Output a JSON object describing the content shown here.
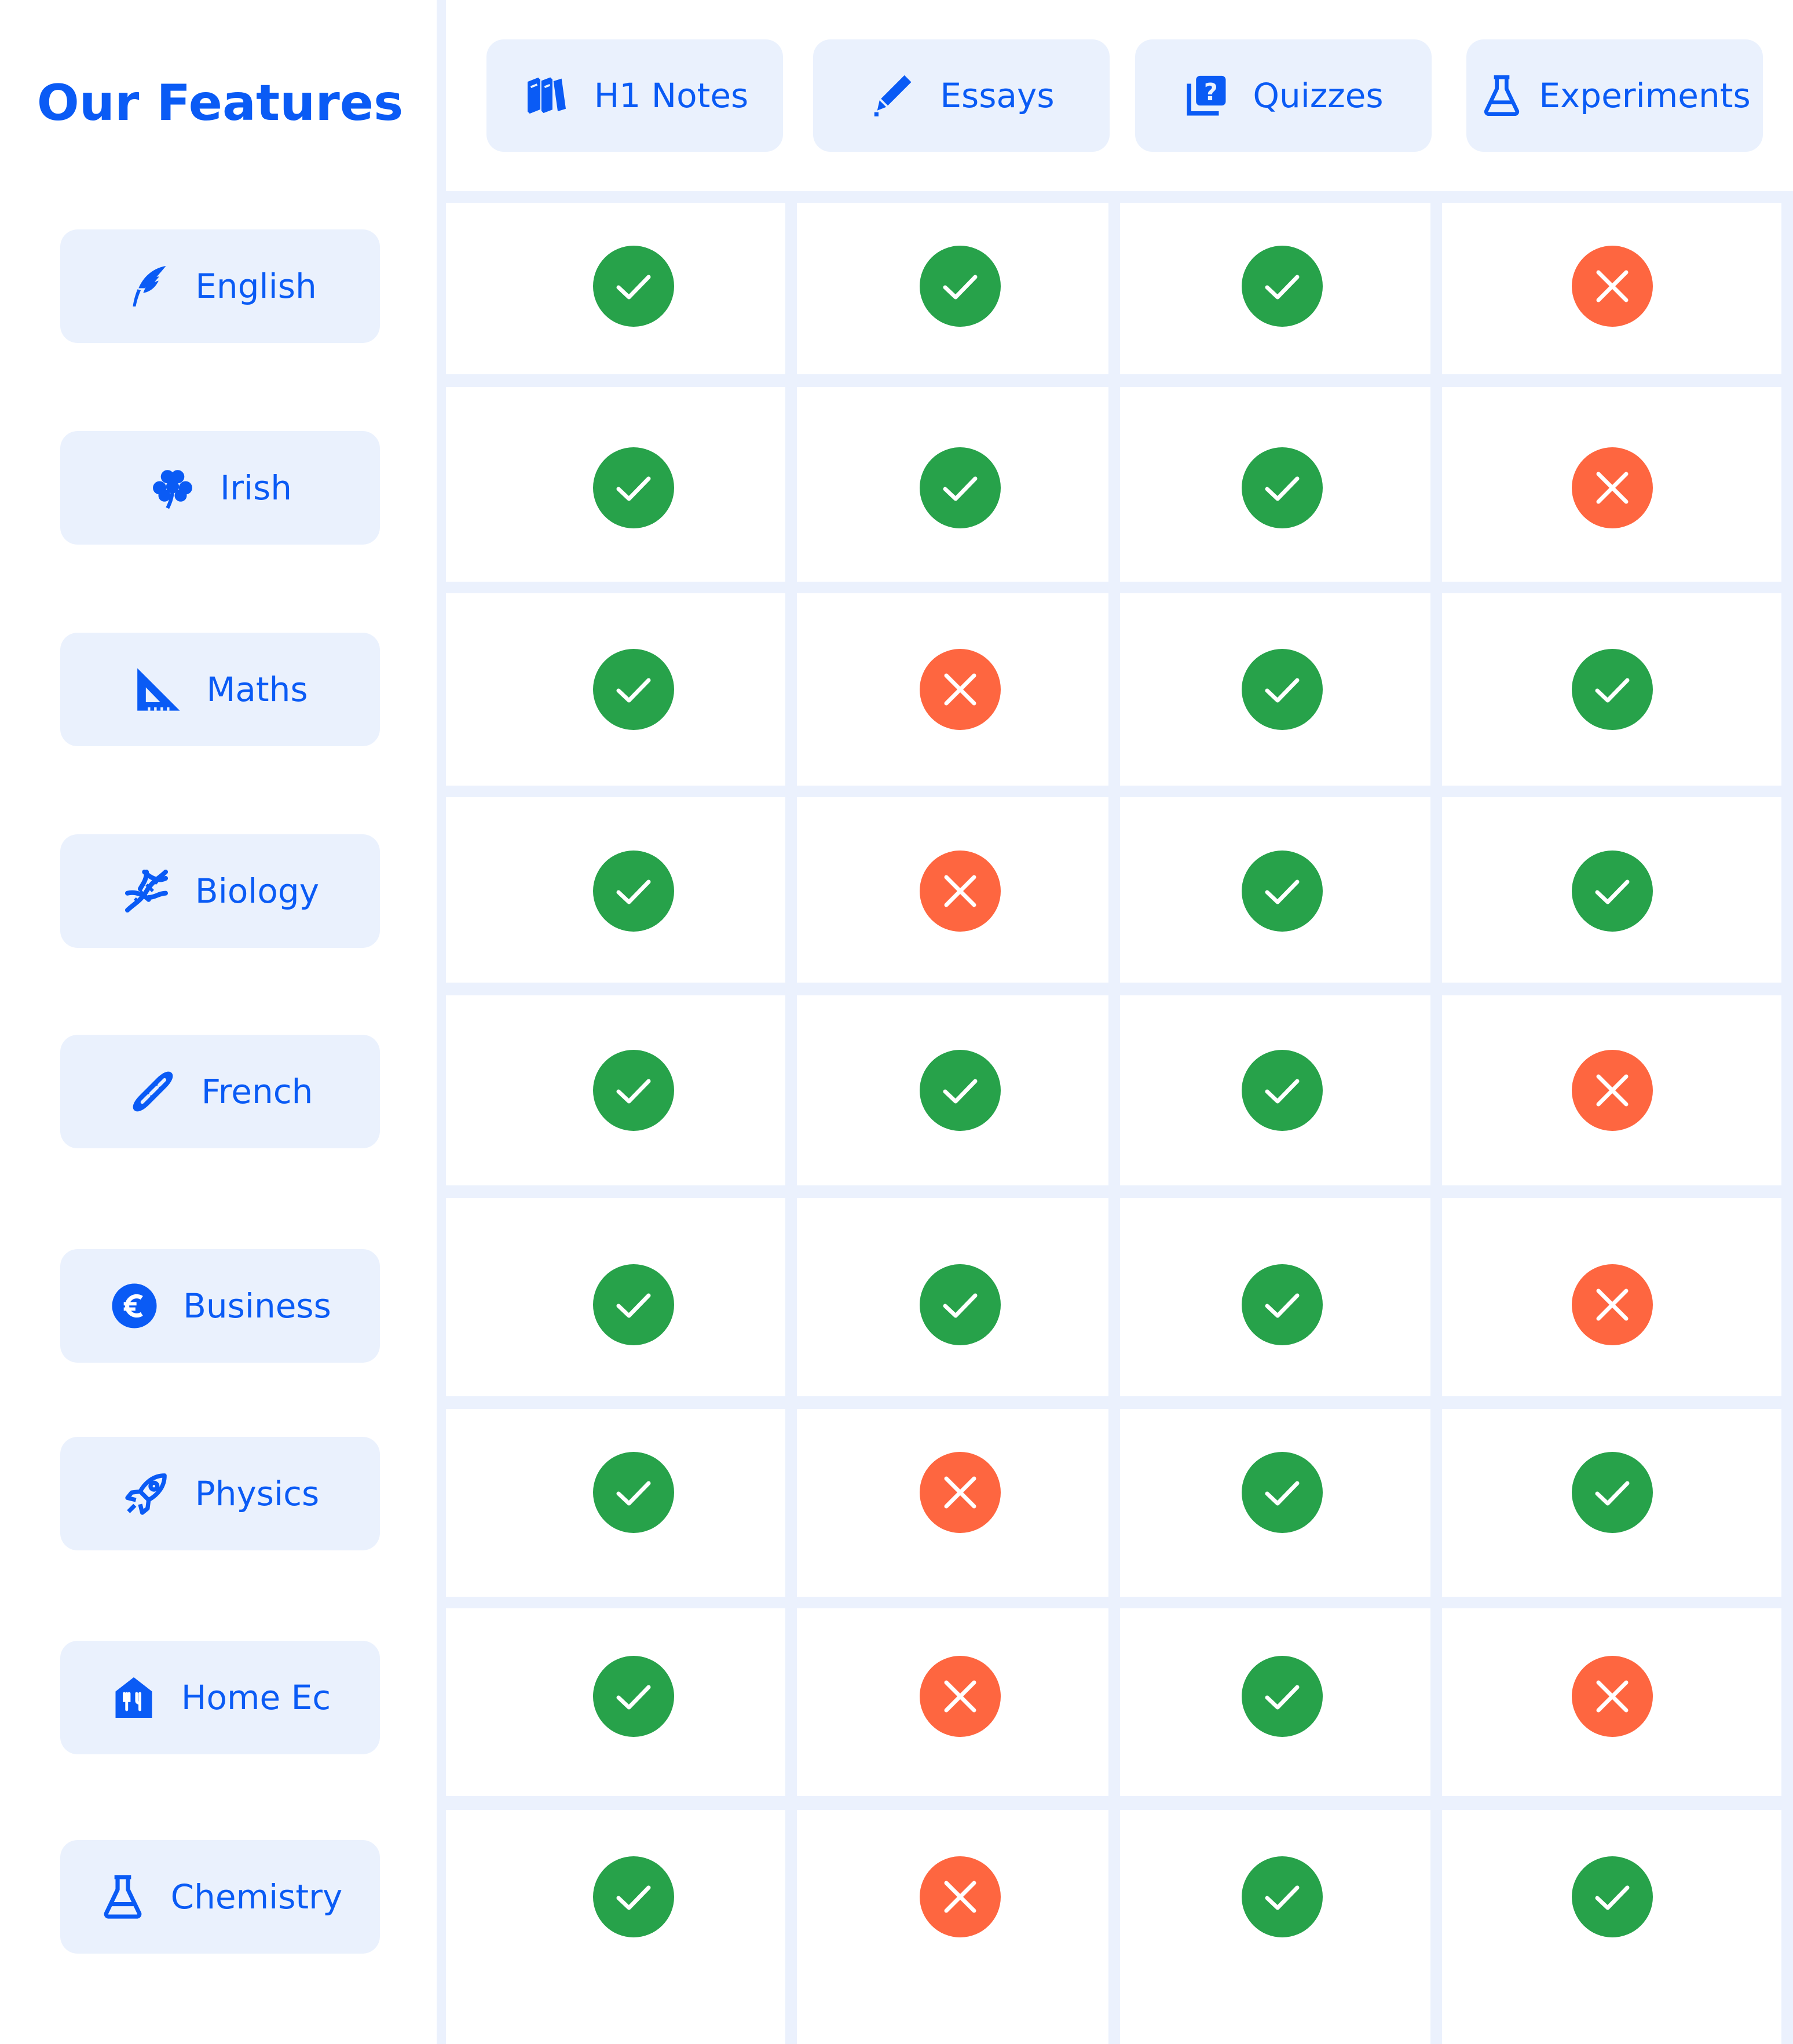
{
  "title": "Our Features",
  "colors": {
    "accent": "#0a5bf5",
    "pill_bg": "#eaf1fd",
    "yes": "#27a24a",
    "no": "#fe6640",
    "grid": "#ebf1fd"
  },
  "columns": [
    {
      "label": "H1 Notes",
      "icon": "books-icon"
    },
    {
      "label": "Essays",
      "icon": "pencil-icon"
    },
    {
      "label": "Quizzes",
      "icon": "quiz-icon"
    },
    {
      "label": "Experiments",
      "icon": "flask-icon"
    }
  ],
  "rows": [
    {
      "label": "English",
      "icon": "quill-icon",
      "features": [
        true,
        true,
        true,
        false
      ]
    },
    {
      "label": "Irish",
      "icon": "shamrock-icon",
      "features": [
        true,
        true,
        true,
        false
      ]
    },
    {
      "label": "Maths",
      "icon": "set-square-icon",
      "features": [
        true,
        false,
        true,
        true
      ]
    },
    {
      "label": "Biology",
      "icon": "dna-icon",
      "features": [
        true,
        false,
        true,
        true
      ]
    },
    {
      "label": "French",
      "icon": "baguette-icon",
      "features": [
        true,
        true,
        true,
        false
      ]
    },
    {
      "label": "Business",
      "icon": "euro-icon",
      "features": [
        true,
        true,
        true,
        false
      ]
    },
    {
      "label": "Physics",
      "icon": "rocket-icon",
      "features": [
        true,
        false,
        true,
        true
      ]
    },
    {
      "label": "Home Ec",
      "icon": "home-utensils-icon",
      "features": [
        true,
        false,
        true,
        false
      ]
    },
    {
      "label": "Chemistry",
      "icon": "flask-icon",
      "features": [
        true,
        false,
        true,
        true
      ]
    }
  ]
}
